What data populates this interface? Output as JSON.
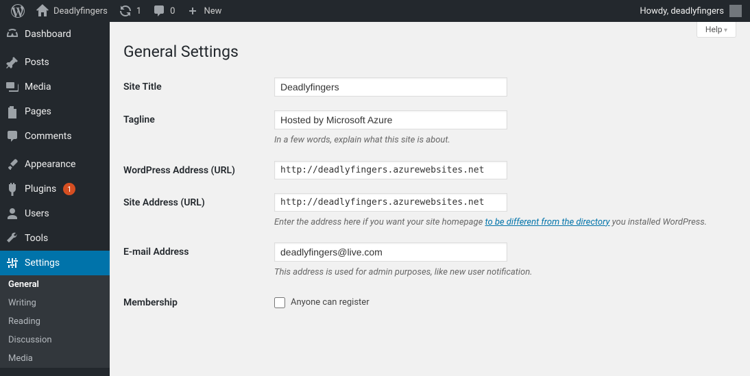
{
  "adminbar": {
    "site_name": "Deadlyfingers",
    "updates": "1",
    "comments": "0",
    "new": "New",
    "howdy": "Howdy, deadlyfingers"
  },
  "sidebar": {
    "items": [
      {
        "label": "Dashboard"
      },
      {
        "label": "Posts"
      },
      {
        "label": "Media"
      },
      {
        "label": "Pages"
      },
      {
        "label": "Comments"
      },
      {
        "label": "Appearance"
      },
      {
        "label": "Plugins",
        "badge": "1"
      },
      {
        "label": "Users"
      },
      {
        "label": "Tools"
      },
      {
        "label": "Settings"
      }
    ],
    "submenu": [
      {
        "label": "General"
      },
      {
        "label": "Writing"
      },
      {
        "label": "Reading"
      },
      {
        "label": "Discussion"
      },
      {
        "label": "Media"
      }
    ]
  },
  "content": {
    "help": "Help",
    "title": "General Settings",
    "rows": {
      "site_title": {
        "label": "Site Title",
        "value": "Deadlyfingers"
      },
      "tagline": {
        "label": "Tagline",
        "value": "Hosted by Microsoft Azure",
        "desc": "In a few words, explain what this site is about."
      },
      "wp_url": {
        "label": "WordPress Address (URL)",
        "value": "http://deadlyfingers.azurewebsites.net"
      },
      "site_url": {
        "label": "Site Address (URL)",
        "value": "http://deadlyfingers.azurewebsites.net",
        "desc_pre": "Enter the address here if you want your site homepage ",
        "desc_link": "to be different from the directory",
        "desc_post": " you installed WordPress."
      },
      "email": {
        "label": "E-mail Address",
        "value": "deadlyfingers@live.com",
        "desc": "This address is used for admin purposes, like new user notification."
      },
      "membership": {
        "label": "Membership",
        "checkbox": "Anyone can register"
      }
    }
  }
}
